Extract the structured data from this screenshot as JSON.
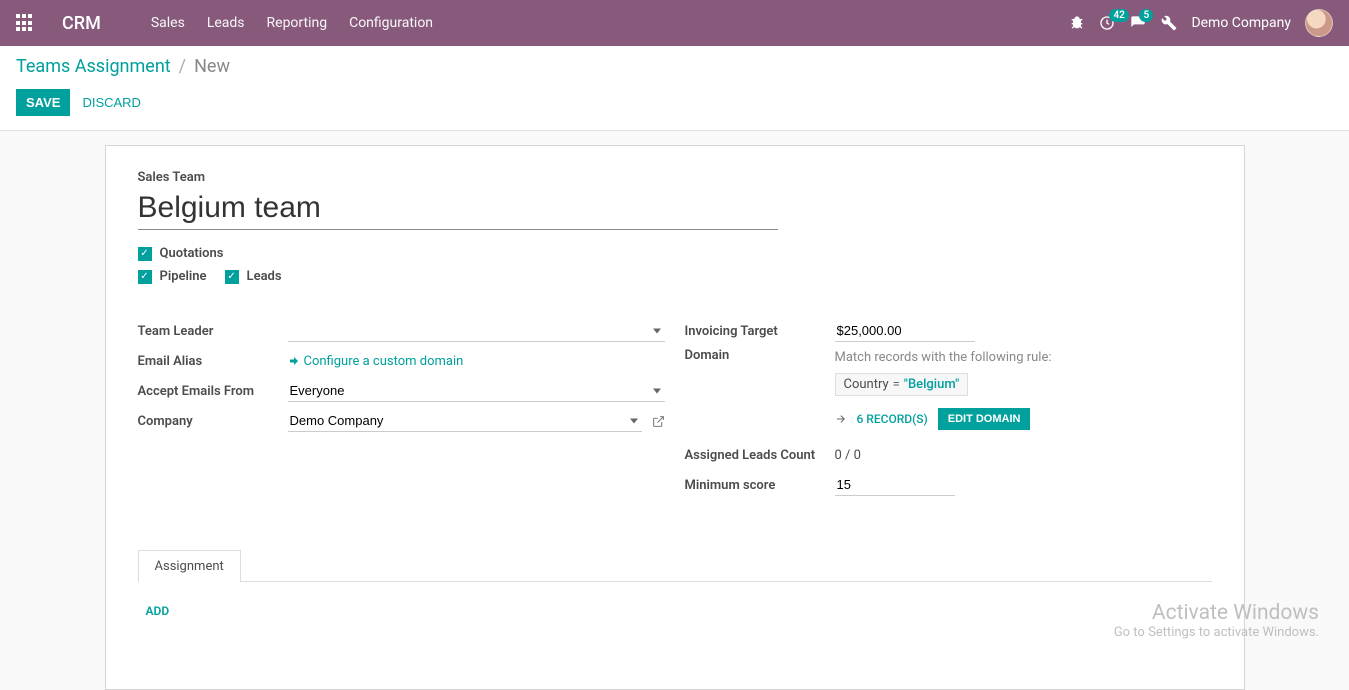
{
  "header": {
    "brand": "CRM",
    "nav": [
      "Sales",
      "Leads",
      "Reporting",
      "Configuration"
    ],
    "activity_badge": "42",
    "message_badge": "5",
    "company": "Demo Company"
  },
  "breadcrumb": {
    "root": "Teams Assignment",
    "current": "New"
  },
  "actions": {
    "save": "Save",
    "discard": "Discard"
  },
  "form": {
    "title_label": "Sales Team",
    "title_value": "Belgium team",
    "checks": {
      "quotations": "Quotations",
      "pipeline": "Pipeline",
      "leads": "Leads"
    },
    "left": {
      "team_leader_label": "Team Leader",
      "team_leader_value": "",
      "email_alias_label": "Email Alias",
      "email_alias_config": "Configure a custom domain",
      "accept_emails_label": "Accept Emails From",
      "accept_emails_value": "Everyone",
      "company_label": "Company",
      "company_value": "Demo Company"
    },
    "right": {
      "invoicing_target_label": "Invoicing Target",
      "invoicing_target_value": "$25,000.00",
      "domain_label": "Domain",
      "domain_hint": "Match records with the following rule:",
      "domain_field": "Country",
      "domain_op": "=",
      "domain_value": "\"Belgium\"",
      "records_link": "6 record(s)",
      "edit_domain": "Edit Domain",
      "assigned_leads_label": "Assigned Leads Count",
      "assigned_leads_value": "0 / 0",
      "min_score_label": "Minimum score",
      "min_score_value": "15"
    },
    "notebook": {
      "tab1": "Assignment",
      "add": "Add"
    }
  },
  "watermark": {
    "line1": "Activate Windows",
    "line2": "Go to Settings to activate Windows."
  }
}
